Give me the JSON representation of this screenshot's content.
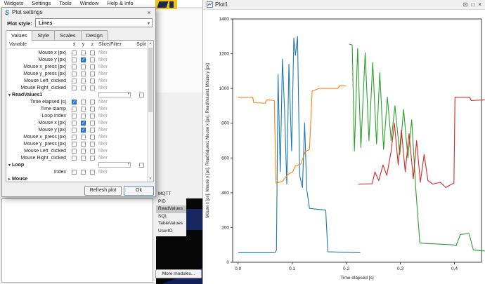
{
  "app": {
    "menu": [
      "Widgets",
      "Settings",
      "Tools",
      "Window",
      "Help & Info"
    ]
  },
  "modules": {
    "items": [
      "MQTT",
      "PID",
      "ReadValues",
      "SQL",
      "TableValues",
      "UserIO"
    ],
    "selected": "ReadValues",
    "more_button": "More modules..."
  },
  "dialog": {
    "title": "Plot settings",
    "close_icon": "×",
    "plot_style_label": "Plot style:",
    "plot_style_value": "Lines",
    "tabs": [
      "Values",
      "Style",
      "Scales",
      "Design"
    ],
    "active_tab": "Values",
    "table": {
      "headers": [
        "Variable",
        "x",
        "y",
        "z",
        "Slice/Filter",
        "Split"
      ],
      "filter_label": "filter",
      "rows": [
        {
          "name": "Mouse x [px]",
          "type": "var",
          "x": false,
          "y": false,
          "z": false
        },
        {
          "name": "Mouse y [px]",
          "type": "var",
          "x": false,
          "y": true,
          "z": false
        },
        {
          "name": "Mouse x_press [px]",
          "type": "var",
          "x": false,
          "y": false,
          "z": false
        },
        {
          "name": "Mouse y_press [px]",
          "type": "var",
          "x": false,
          "y": false,
          "z": false
        },
        {
          "name": "Mouse Left_clicked",
          "type": "var",
          "x": false,
          "y": false,
          "z": false
        },
        {
          "name": "Mouse Right_clicked",
          "type": "var",
          "x": false,
          "y": false,
          "z": false
        },
        {
          "name": "ReadValues1",
          "type": "group",
          "dropdown": true,
          "split": false
        },
        {
          "name": "Time elapsed [s]",
          "type": "var",
          "x": true,
          "y": false,
          "z": false
        },
        {
          "name": "Time stamp",
          "type": "var",
          "x": false,
          "y": false,
          "z": false
        },
        {
          "name": "Loop Index",
          "type": "var",
          "x": false,
          "y": false,
          "z": false
        },
        {
          "name": "Mouse x [px]",
          "type": "var",
          "x": false,
          "y": true,
          "z": false
        },
        {
          "name": "Mouse y [px]",
          "type": "var",
          "x": false,
          "y": true,
          "z": false
        },
        {
          "name": "Mouse x_press [px]",
          "type": "var",
          "x": false,
          "y": false,
          "z": false
        },
        {
          "name": "Mouse y_press [px]",
          "type": "var",
          "x": false,
          "y": false,
          "z": false
        },
        {
          "name": "Mouse Left_clicked",
          "type": "var",
          "x": false,
          "y": false,
          "z": false
        },
        {
          "name": "Mouse Right_clicked",
          "type": "var",
          "x": false,
          "y": false,
          "z": false
        },
        {
          "name": "Loop",
          "type": "group",
          "dropdown": true,
          "split": false
        },
        {
          "name": "Index",
          "type": "var",
          "x": false,
          "y": false,
          "z": false
        },
        {
          "name": "Mouse",
          "type": "group_collapsed",
          "dropdown": false
        }
      ]
    },
    "buttons": {
      "refresh": "Refresh plot",
      "ok": "Ok"
    }
  },
  "plot_window": {
    "title": "Plot1",
    "icons": {
      "dock": "⊡",
      "maximize": "□",
      "close": "×"
    }
  },
  "chart_data": {
    "type": "line",
    "title": "",
    "xlabel": "Time elapsed [s]",
    "ylabel": "Mouse x [px], Mouse y [px], ReadValues1 Mouse x [px], ReadValues1 Mouse y [px]",
    "xlim": [
      -0.01,
      0.45
    ],
    "ylim": [
      0,
      1400
    ],
    "xticks": [
      0,
      0.1,
      0.2,
      0.3,
      0.4
    ],
    "yticks": [
      0,
      200,
      400,
      600,
      800,
      1000,
      1200,
      1400
    ],
    "grid": false,
    "legend": null,
    "series": [
      {
        "name": "Mouse x [px]",
        "color": "#1f77b4",
        "points": [
          [
            0.0,
            55
          ],
          [
            0.068,
            55
          ],
          [
            0.071,
            70
          ],
          [
            0.074,
            1080
          ],
          [
            0.078,
            520
          ],
          [
            0.082,
            1170
          ],
          [
            0.086,
            870
          ],
          [
            0.09,
            450
          ],
          [
            0.094,
            1140
          ],
          [
            0.099,
            640
          ],
          [
            0.103,
            1290
          ],
          [
            0.106,
            1190
          ],
          [
            0.11,
            1300
          ],
          [
            0.114,
            500
          ],
          [
            0.119,
            430
          ],
          [
            0.123,
            800
          ],
          [
            0.127,
            420
          ],
          [
            0.132,
            310
          ],
          [
            0.162,
            300
          ],
          [
            0.166,
            60
          ],
          [
            0.226,
            55
          ]
        ]
      },
      {
        "name": "Mouse y [px]",
        "color": "#ff7f0e",
        "points": [
          [
            0.0,
            950
          ],
          [
            0.027,
            950
          ],
          [
            0.029,
            918
          ],
          [
            0.05,
            915
          ],
          [
            0.053,
            935
          ],
          [
            0.067,
            930
          ],
          [
            0.07,
            455
          ],
          [
            0.082,
            465
          ],
          [
            0.092,
            505
          ],
          [
            0.101,
            520
          ],
          [
            0.106,
            555
          ],
          [
            0.116,
            565
          ],
          [
            0.124,
            635
          ],
          [
            0.132,
            650
          ],
          [
            0.137,
            985
          ],
          [
            0.15,
            1000
          ],
          [
            0.184,
            1000
          ],
          [
            0.188,
            1015
          ],
          [
            0.2,
            1015
          ]
        ]
      },
      {
        "name": "ReadValues1 Mouse x [px]",
        "color": "#2ca02c",
        "points": [
          [
            0.205,
            1255
          ],
          [
            0.211,
            1250
          ],
          [
            0.215,
            640
          ],
          [
            0.221,
            1230
          ],
          [
            0.227,
            660
          ],
          [
            0.235,
            1205
          ],
          [
            0.242,
            700
          ],
          [
            0.249,
            1150
          ],
          [
            0.256,
            680
          ],
          [
            0.262,
            1090
          ],
          [
            0.269,
            650
          ],
          [
            0.276,
            950
          ],
          [
            0.283,
            700
          ],
          [
            0.29,
            900
          ],
          [
            0.299,
            620
          ],
          [
            0.306,
            880
          ],
          [
            0.314,
            600
          ],
          [
            0.321,
            820
          ],
          [
            0.329,
            400
          ],
          [
            0.336,
            110
          ],
          [
            0.398,
            100
          ],
          [
            0.403,
            95
          ],
          [
            0.411,
            160
          ],
          [
            0.427,
            165
          ],
          [
            0.435,
            70
          ],
          [
            0.456,
            65
          ]
        ]
      },
      {
        "name": "ReadValues1 Mouse y [px]",
        "color": "#d62728",
        "points": [
          [
            0.222,
            450
          ],
          [
            0.248,
            452
          ],
          [
            0.253,
            520
          ],
          [
            0.26,
            470
          ],
          [
            0.268,
            560
          ],
          [
            0.275,
            500
          ],
          [
            0.283,
            640
          ],
          [
            0.289,
            800
          ],
          [
            0.296,
            560
          ],
          [
            0.302,
            760
          ],
          [
            0.309,
            520
          ],
          [
            0.316,
            740
          ],
          [
            0.324,
            480
          ],
          [
            0.33,
            700
          ],
          [
            0.337,
            460
          ],
          [
            0.344,
            620
          ],
          [
            0.351,
            470
          ],
          [
            0.36,
            450
          ],
          [
            0.374,
            460
          ],
          [
            0.384,
            430
          ],
          [
            0.395,
            450
          ],
          [
            0.399,
            455
          ],
          [
            0.401,
            950
          ],
          [
            0.428,
            950
          ],
          [
            0.431,
            930
          ],
          [
            0.456,
            935
          ]
        ]
      }
    ]
  }
}
